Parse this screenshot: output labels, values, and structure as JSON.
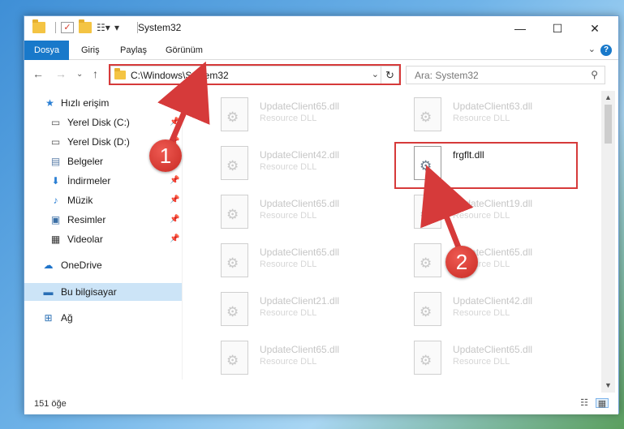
{
  "window": {
    "title": "System32"
  },
  "ribbon": {
    "tabs": [
      "Dosya",
      "Giriş",
      "Paylaş",
      "Görünüm"
    ],
    "help": "?"
  },
  "address": {
    "path": "C:\\Windows\\System32",
    "search_placeholder": "Ara: System32"
  },
  "nav": {
    "items": [
      {
        "label": "Hızlı erişim",
        "icon": "star-icon",
        "pinned": false
      },
      {
        "label": "Yerel Disk (C:)",
        "icon": "drive-icon",
        "pinned": true
      },
      {
        "label": "Yerel Disk (D:)",
        "icon": "drive-icon",
        "pinned": true
      },
      {
        "label": "Belgeler",
        "icon": "documents-icon",
        "pinned": true
      },
      {
        "label": "İndirmeler",
        "icon": "download-icon",
        "pinned": true
      },
      {
        "label": "Müzik",
        "icon": "music-icon",
        "pinned": true
      },
      {
        "label": "Resimler",
        "icon": "pictures-icon",
        "pinned": true
      },
      {
        "label": "Videolar",
        "icon": "video-icon",
        "pinned": true
      },
      {
        "label": "OneDrive",
        "icon": "cloud-icon",
        "pinned": false
      },
      {
        "label": "Bu bilgisayar",
        "icon": "computer-icon",
        "pinned": false,
        "selected": true
      },
      {
        "label": "Ağ",
        "icon": "network-icon",
        "pinned": false
      }
    ]
  },
  "files": [
    {
      "name": "UpdateClient65.dll",
      "type": "Resource DLL"
    },
    {
      "name": "UpdateClient63.dll",
      "type": "Resource DLL"
    },
    {
      "name": "UpdateClient42.dll",
      "type": "Resource DLL"
    },
    {
      "name": "frgflt.dll",
      "type": "",
      "highlighted": true
    },
    {
      "name": "UpdateClient65.dll",
      "type": "Resource DLL"
    },
    {
      "name": "UpdateClient19.dll",
      "type": "Resource DLL"
    },
    {
      "name": "UpdateClient65.dll",
      "type": "Resource DLL"
    },
    {
      "name": "UpdateClient65.dll",
      "type": "Resource DLL"
    },
    {
      "name": "UpdateClient21.dll",
      "type": "Resource DLL"
    },
    {
      "name": "UpdateClient42.dll",
      "type": "Resource DLL"
    },
    {
      "name": "UpdateClient65.dll",
      "type": "Resource DLL"
    },
    {
      "name": "UpdateClient65.dll",
      "type": "Resource DLL"
    }
  ],
  "status": {
    "count": "151 öğe"
  },
  "annotations": {
    "step1": "1",
    "step2": "2",
    "color": "#d63a3a"
  }
}
